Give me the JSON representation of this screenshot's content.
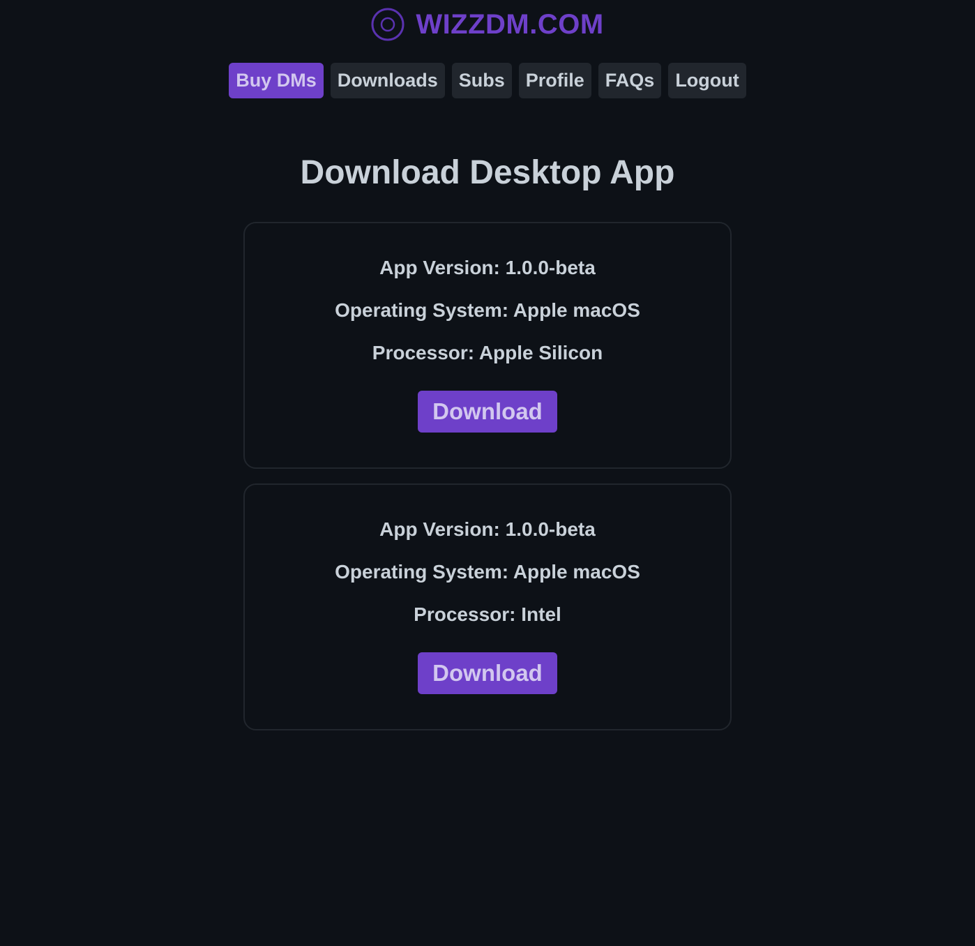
{
  "brand": {
    "name": "WIZZDM.COM",
    "logo_icon": "ring-logo-icon",
    "color": "#6e40c9"
  },
  "nav": {
    "items": [
      {
        "label": "Buy DMs",
        "active": true
      },
      {
        "label": "Downloads",
        "active": false
      },
      {
        "label": "Subs",
        "active": false
      },
      {
        "label": "Profile",
        "active": false
      },
      {
        "label": "FAQs",
        "active": false
      },
      {
        "label": "Logout",
        "active": false
      }
    ]
  },
  "main": {
    "title": "Download Desktop App",
    "downloads": [
      {
        "version": "App Version: 1.0.0-beta",
        "os": "Operating System: Apple macOS",
        "processor": "Processor: Apple Silicon",
        "button_label": "Download"
      },
      {
        "version": "App Version: 1.0.0-beta",
        "os": "Operating System: Apple macOS",
        "processor": "Processor: Intel",
        "button_label": "Download"
      }
    ]
  },
  "colors": {
    "background": "#0d1117",
    "accent": "#6e40c9",
    "nav_button": "#21262d",
    "text": "#c9d1d9"
  }
}
